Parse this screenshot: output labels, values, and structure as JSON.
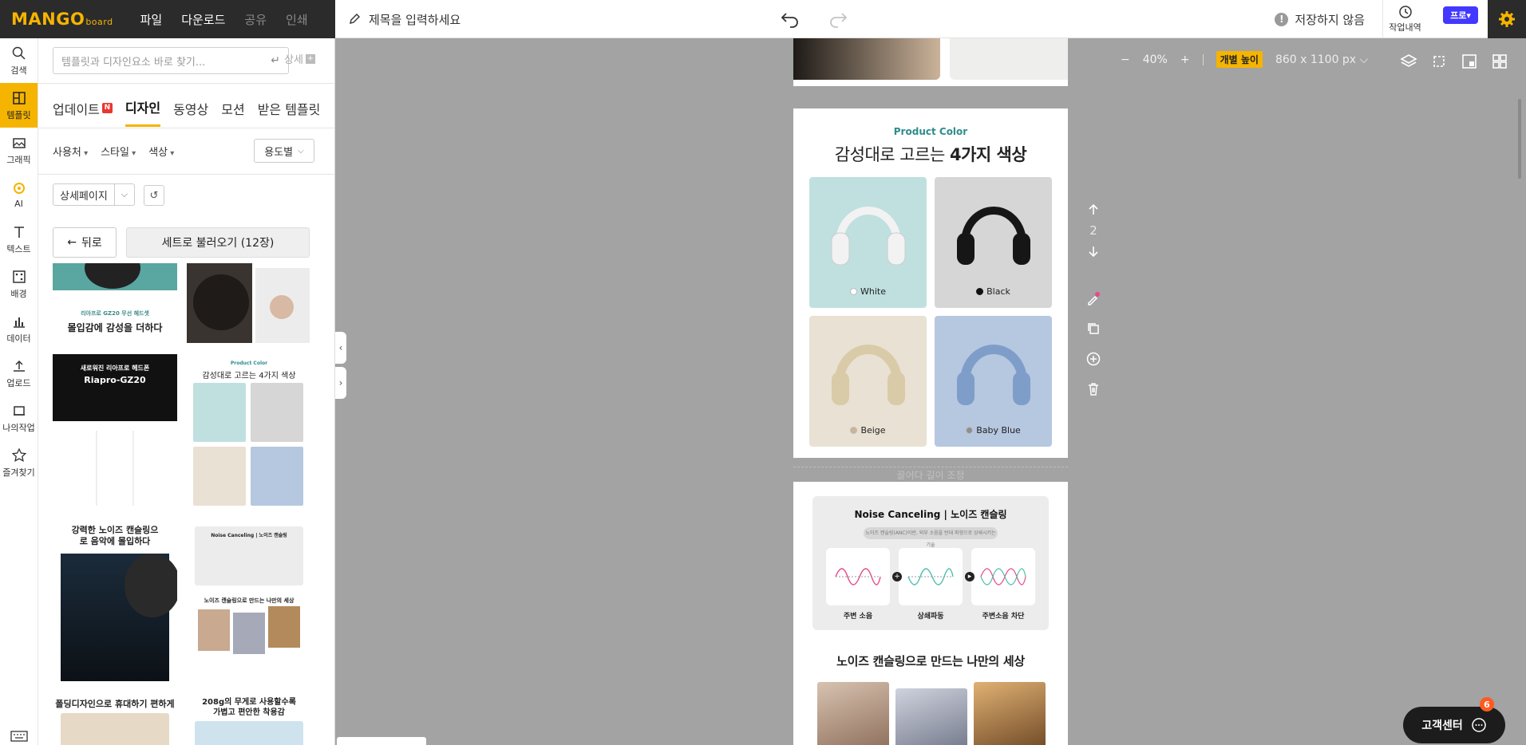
{
  "brand": {
    "logo": "MANGO",
    "logo_suffix": "board"
  },
  "topmenu": {
    "file": "파일",
    "download": "다운로드",
    "share": "공유",
    "print": "인쇄"
  },
  "toolbar": {
    "title_placeholder": "제목을 입력하세요",
    "save_status": "저장하지 않음",
    "history": "작업내역",
    "pro": "프로"
  },
  "rail": [
    {
      "label": "검색",
      "icon": "search-icon"
    },
    {
      "label": "템플릿",
      "icon": "template-icon"
    },
    {
      "label": "그래픽",
      "icon": "graphic-icon"
    },
    {
      "label": "AI",
      "icon": "ai-icon"
    },
    {
      "label": "텍스트",
      "icon": "text-icon"
    },
    {
      "label": "배경",
      "icon": "background-icon"
    },
    {
      "label": "데이터",
      "icon": "chart-icon"
    },
    {
      "label": "업로드",
      "icon": "upload-icon"
    },
    {
      "label": "나의작업",
      "icon": "folder-icon"
    },
    {
      "label": "즐겨찾기",
      "icon": "star-icon"
    }
  ],
  "panel": {
    "search_placeholder": "템플릿과 디자인요소 바로 찾기...",
    "detail": "상세",
    "tabs": [
      "업데이트",
      "디자인",
      "동영상",
      "모션",
      "받은 템플릿"
    ],
    "new_badge": "N",
    "filters": [
      "사용처",
      "스타일",
      "색상"
    ],
    "purpose": "용도별",
    "category": "상세페이지",
    "back": "뒤로",
    "load_set": "세트로 불러오기 (12장)",
    "thumb_texts": {
      "t1": "몰입감에 감성을 더하다",
      "t1_small": "리아프로 GZ20 무선 헤드셋",
      "t3_head": "새로워진 리아프로 헤드폰",
      "t3_model": "Riapro-GZ20",
      "t4_sub": "Product Color",
      "t4_head": "감성대로 고르는 4가지 색상",
      "t5_head": "강력한 노이즈 캔슬링으로 음악에 몰입하다",
      "t6_head": "Noise Canceling | 노이즈 캔슬링",
      "t6_head2": "노이즈 캔슬링으로 만드는 나만의 세상",
      "t7_head": "폴딩디자인으로 휴대하기 편하게",
      "t8_head": "208g의 무게로 사용할수록 가볍고 편안한 착용감"
    }
  },
  "canvas": {
    "zoom": "40%",
    "height_mode": "개별 높이",
    "page_size": "860 x 1100 px",
    "page_number": "2",
    "resize_hint": "끌어다 길이 조정",
    "product_color": {
      "subtitle": "Product Color",
      "title_light": "감성대로 고르는",
      "title_bold": "4가지 색상",
      "swatches": [
        {
          "name": "White",
          "bg": "#bfe0df",
          "cup": "#f2f2f2",
          "dot": "#ffffff"
        },
        {
          "name": "Black",
          "bg": "#d6d6d6",
          "cup": "#161616",
          "dot": "#111111"
        },
        {
          "name": "Beige",
          "bg": "#e9e1d3",
          "cup": "#d9cba8",
          "dot": "#c9b591"
        },
        {
          "name": "Baby Blue",
          "bg": "#b6c7e0",
          "cup": "#7f9dc9",
          "dot": "#8f8f8f"
        }
      ]
    },
    "noise": {
      "title": "Noise Canceling",
      "title_ko": "노이즈 캔슬링",
      "pill": "노이즈 캔슬링(ANC)이란, 외부 소음을 반대 파형으로 상쇄시키는 기술",
      "labels": [
        "주변 소음",
        "상쇄파동",
        "주변소음 차단"
      ],
      "heading": "노이즈 캔슬링으로 만드는 나만의 세상"
    }
  },
  "support": {
    "label": "고객센터",
    "badge": "6"
  },
  "colors": {
    "accent": "#f5b400",
    "pro": "#4338ff",
    "dark": "#2b2b2b"
  }
}
